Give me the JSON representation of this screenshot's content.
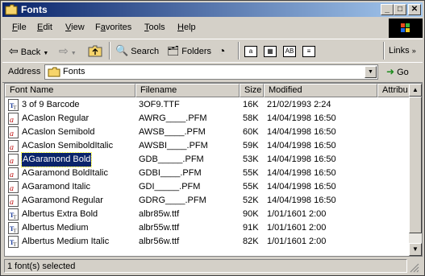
{
  "window": {
    "title": "Fonts"
  },
  "menu": [
    {
      "label": "File",
      "key": "F",
      "rest": "ile"
    },
    {
      "label": "Edit",
      "key": "E",
      "rest": "dit"
    },
    {
      "label": "View",
      "key": "V",
      "rest": "iew"
    },
    {
      "label": "Favorites",
      "key": "a",
      "pre": "F",
      "rest": "vorites"
    },
    {
      "label": "Tools",
      "key": "T",
      "rest": "ools"
    },
    {
      "label": "Help",
      "key": "H",
      "rest": "elp"
    }
  ],
  "toolbar": {
    "back_label": "Back",
    "search_label": "Search",
    "folders_label": "Folders",
    "links_label": "Links"
  },
  "address": {
    "label": "Address",
    "value": "Fonts",
    "go_label": "Go"
  },
  "columns": [
    "Font Name",
    "Filename",
    "Size",
    "Modified",
    "Attribu"
  ],
  "rows": [
    {
      "name": "3 of 9 Barcode",
      "file": "3OF9.TTF",
      "size": "16K",
      "modified": "21/02/1993 2:24",
      "type": "tt"
    },
    {
      "name": "ACaslon Regular",
      "file": "AWRG____.PFM",
      "size": "58K",
      "modified": "14/04/1998 16:50",
      "type": "a"
    },
    {
      "name": "ACaslon Semibold",
      "file": "AWSB____.PFM",
      "size": "60K",
      "modified": "14/04/1998 16:50",
      "type": "a"
    },
    {
      "name": "ACaslon SemiboldItalic",
      "file": "AWSBI____.PFM",
      "size": "59K",
      "modified": "14/04/1998 16:50",
      "type": "a"
    },
    {
      "name": "AGaramond Bold",
      "file": "GDB_____.PFM",
      "size": "53K",
      "modified": "14/04/1998 16:50",
      "type": "a",
      "selected": true
    },
    {
      "name": "AGaramond BoldItalic",
      "file": "GDBI____.PFM",
      "size": "55K",
      "modified": "14/04/1998 16:50",
      "type": "a"
    },
    {
      "name": "AGaramond Italic",
      "file": "GDI_____.PFM",
      "size": "55K",
      "modified": "14/04/1998 16:50",
      "type": "a"
    },
    {
      "name": "AGaramond Regular",
      "file": "GDRG____.PFM",
      "size": "52K",
      "modified": "14/04/1998 16:50",
      "type": "a"
    },
    {
      "name": "Albertus Extra Bold",
      "file": "albr85w.ttf",
      "size": "90K",
      "modified": "1/01/1601 2:00",
      "type": "tt"
    },
    {
      "name": "Albertus Medium",
      "file": "albr55w.ttf",
      "size": "91K",
      "modified": "1/01/1601 2:00",
      "type": "tt"
    },
    {
      "name": "Albertus Medium Italic",
      "file": "albr56w.ttf",
      "size": "82K",
      "modified": "1/01/1601 2:00",
      "type": "tt"
    }
  ],
  "status": {
    "text": "1 font(s) selected"
  }
}
